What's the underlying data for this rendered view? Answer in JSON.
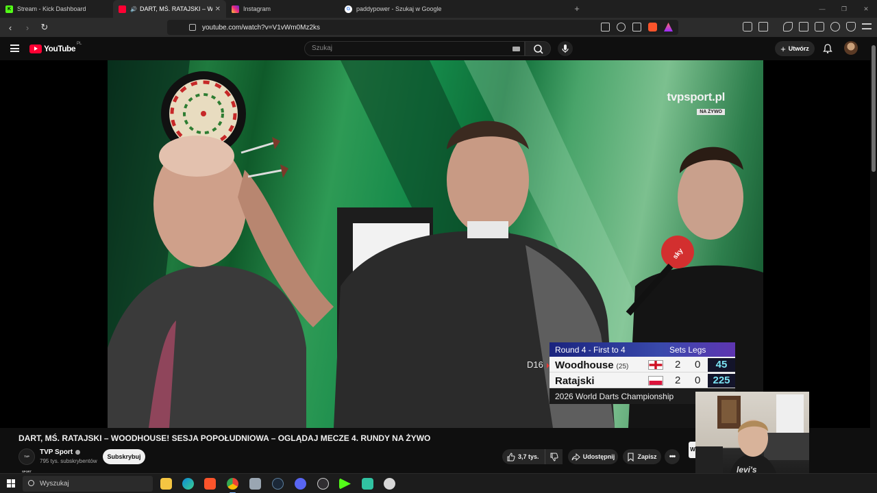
{
  "browser": {
    "tabs": [
      {
        "title": "Stream - Kick Dashboard",
        "favicon": "kick-icon",
        "color": "#53fc18",
        "active": false
      },
      {
        "title": "DART, MŚ. RATAJSKI – WOOD",
        "favicon": "youtube-icon",
        "color": "#ff0033",
        "active": true
      },
      {
        "title": "Instagram",
        "favicon": "instagram-icon",
        "color": "#e1306c",
        "active": false
      },
      {
        "title": "paddypower - Szukaj w Google",
        "favicon": "google-icon",
        "color": "#ffffff",
        "active": false
      }
    ],
    "url": "youtube.com/watch?v=V1vWm0Mz2ks"
  },
  "youtube": {
    "logo": "YouTube",
    "country": "PL",
    "search_placeholder": "Szukaj",
    "create_label": "Utwórz"
  },
  "video": {
    "watermark": "tvpsport.pl",
    "watermark_live": "NA ŻYWO",
    "scoreboard": {
      "round": "Round 4 - First to 4",
      "col_header": "Sets Legs",
      "checkout": "D16",
      "players": [
        {
          "name": "Woodhouse",
          "seed": "(25)",
          "sets": "2",
          "legs": "0",
          "points": "45",
          "flag": "england",
          "throwing": true
        },
        {
          "name": "Ratajski",
          "seed": "",
          "sets": "2",
          "legs": "0",
          "points": "225",
          "flag": "poland",
          "throwing": false
        }
      ],
      "event": "2026 World Darts Championship"
    }
  },
  "details": {
    "title": "DART, MŚ. RATAJSKI – WOODHOUSE! SESJA POPOŁUDNIOWA – OGLĄDAJ MECZE 4. RUNDY NA ŻYWO",
    "channel": "TVP Sport",
    "channel_avatar_text": "TVP SPORT",
    "subscribers": "795 tys. subskrybentów",
    "subscribe_label": "Subskrybuj",
    "likes": "3,7 tys.",
    "share_label": "Udostępnij",
    "save_label": "Zapisz"
  },
  "taskbar": {
    "search_placeholder": "Wyszukaj"
  }
}
